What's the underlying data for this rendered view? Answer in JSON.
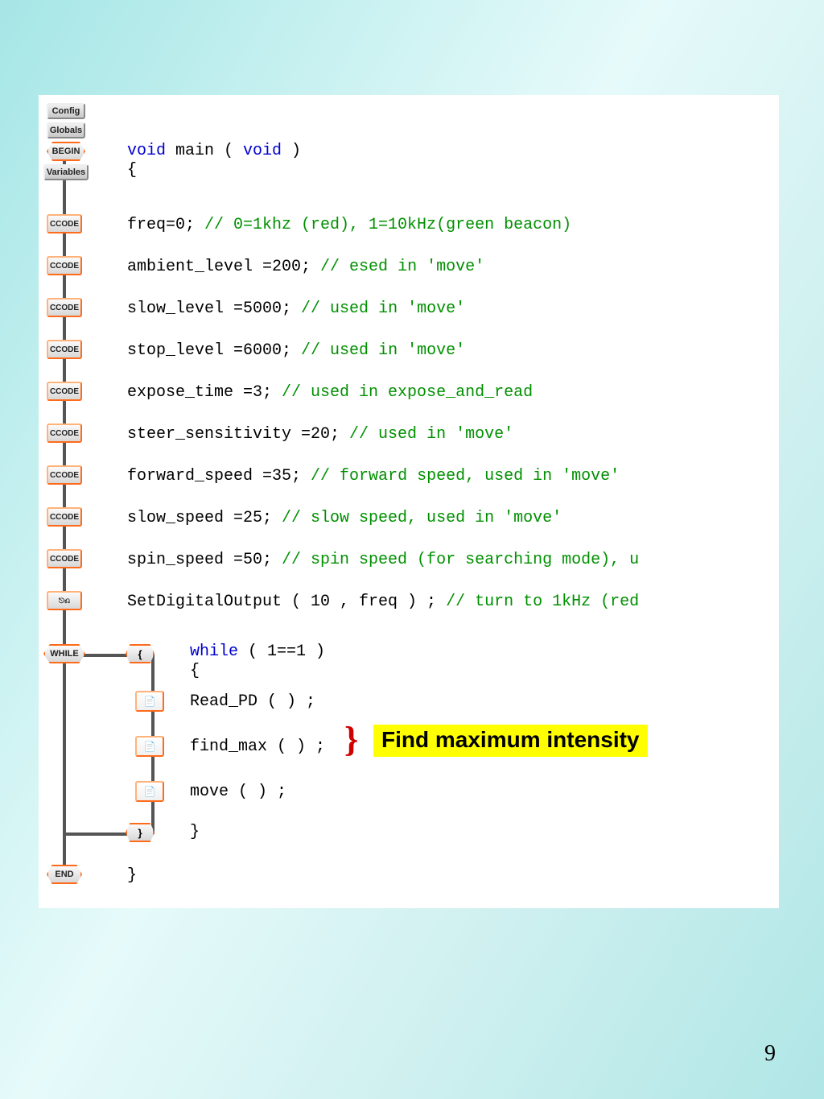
{
  "page_number": "9",
  "buttons": {
    "config": "Config",
    "globals": "Globals",
    "begin": "BEGIN",
    "variables": "Variables",
    "ccode": "CCODE",
    "while": "WHILE",
    "end": "END",
    "dio": "DI O"
  },
  "code": {
    "line_main_pre": "void",
    "line_main_mid": " main ( ",
    "line_main_post": "void",
    "line_main_end": " )",
    "open_brace": "{",
    "freq": "freq=0; ",
    "freq_cm": "// 0=1khz (red), 1=10kHz(green beacon)",
    "ambient": "ambient_level =200; ",
    "ambient_cm": "// esed in 'move'",
    "slow_level": "slow_level =5000; ",
    "slow_level_cm": "// used in 'move'",
    "stop_level": "stop_level =6000; ",
    "stop_level_cm": "// used in 'move'",
    "expose": "expose_time =3; ",
    "expose_cm": "// used in expose_and_read",
    "steer": "steer_sensitivity =20; ",
    "steer_cm": "// used in 'move'",
    "fwd": "forward_speed =35; ",
    "fwd_cm": "// forward speed, used in 'move'",
    "slow_speed": "slow_speed =25; ",
    "slow_speed_cm": "// slow speed, used in 'move'",
    "spin": "spin_speed =50; ",
    "spin_cm": "// spin speed (for searching mode), u",
    "sdo": "SetDigitalOutput ( 10 , freq ) ; ",
    "sdo_cm": "// turn to 1kHz (red",
    "while_kw": "while",
    "while_cond": " ( 1==1 )",
    "while_open": "{",
    "readpd": "Read_PD (   ) ;",
    "findmax": "find_max ( ) ;",
    "move": "move ( ) ;",
    "while_close": "}",
    "close_brace": "}"
  },
  "callout": "Find maximum intensity",
  "brace_symbols": {
    "open": "{",
    "close": "}"
  }
}
